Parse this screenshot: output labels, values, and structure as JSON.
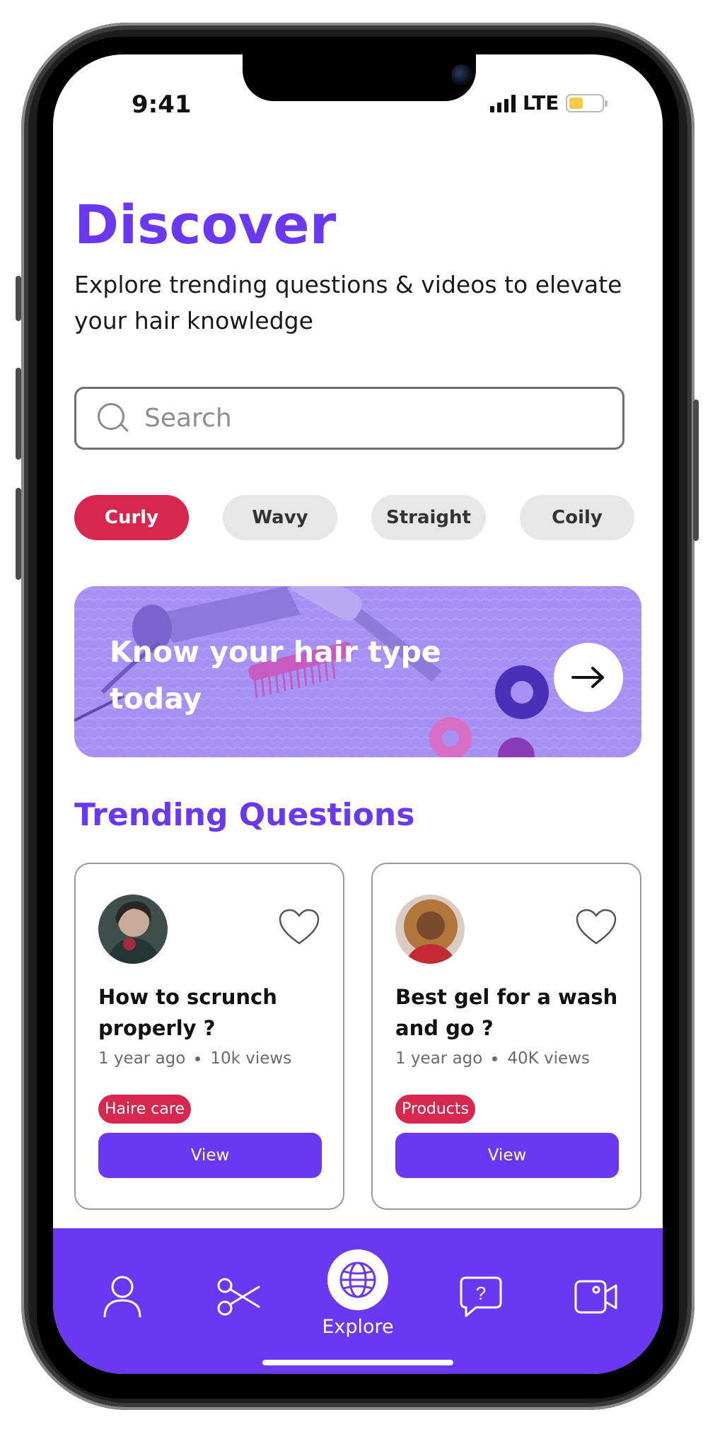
{
  "status_bar": {
    "time": "9:41",
    "network": "LTE"
  },
  "header": {
    "title": "Discover",
    "subtitle": "Explore trending questions & videos to elevate your hair knowledge"
  },
  "search": {
    "placeholder": "Search",
    "value": ""
  },
  "filters": [
    {
      "label": "Curly",
      "active": true
    },
    {
      "label": "Wavy",
      "active": false
    },
    {
      "label": "Straight",
      "active": false
    },
    {
      "label": "Coily",
      "active": false
    }
  ],
  "banner": {
    "text": "Know your hair type today"
  },
  "trending": {
    "title": "Trending Questions",
    "cards": [
      {
        "title": "How to scrunch properly ?",
        "age": "1 year ago",
        "views": "10k views",
        "tag": "Haire care",
        "button": "View",
        "avatar_icon": "user-avatar-photo"
      },
      {
        "title": "Best gel for a wash and go ?",
        "age": "1 year ago",
        "views": "40K views",
        "tag": "Products",
        "button": "View",
        "avatar_icon": "user-avatar-photo"
      }
    ]
  },
  "tabbar": {
    "items": [
      {
        "icon": "profile-icon",
        "label": ""
      },
      {
        "icon": "scissors-icon",
        "label": ""
      },
      {
        "icon": "globe-icon",
        "label": "Explore",
        "active": true
      },
      {
        "icon": "question-bubble-icon",
        "label": ""
      },
      {
        "icon": "video-icon",
        "label": ""
      }
    ]
  },
  "colors": {
    "accent": "#6a38f0",
    "tag": "#d7274f",
    "chip_inactive": "#e7e7e7",
    "banner_overlay": "#a58ff3"
  }
}
